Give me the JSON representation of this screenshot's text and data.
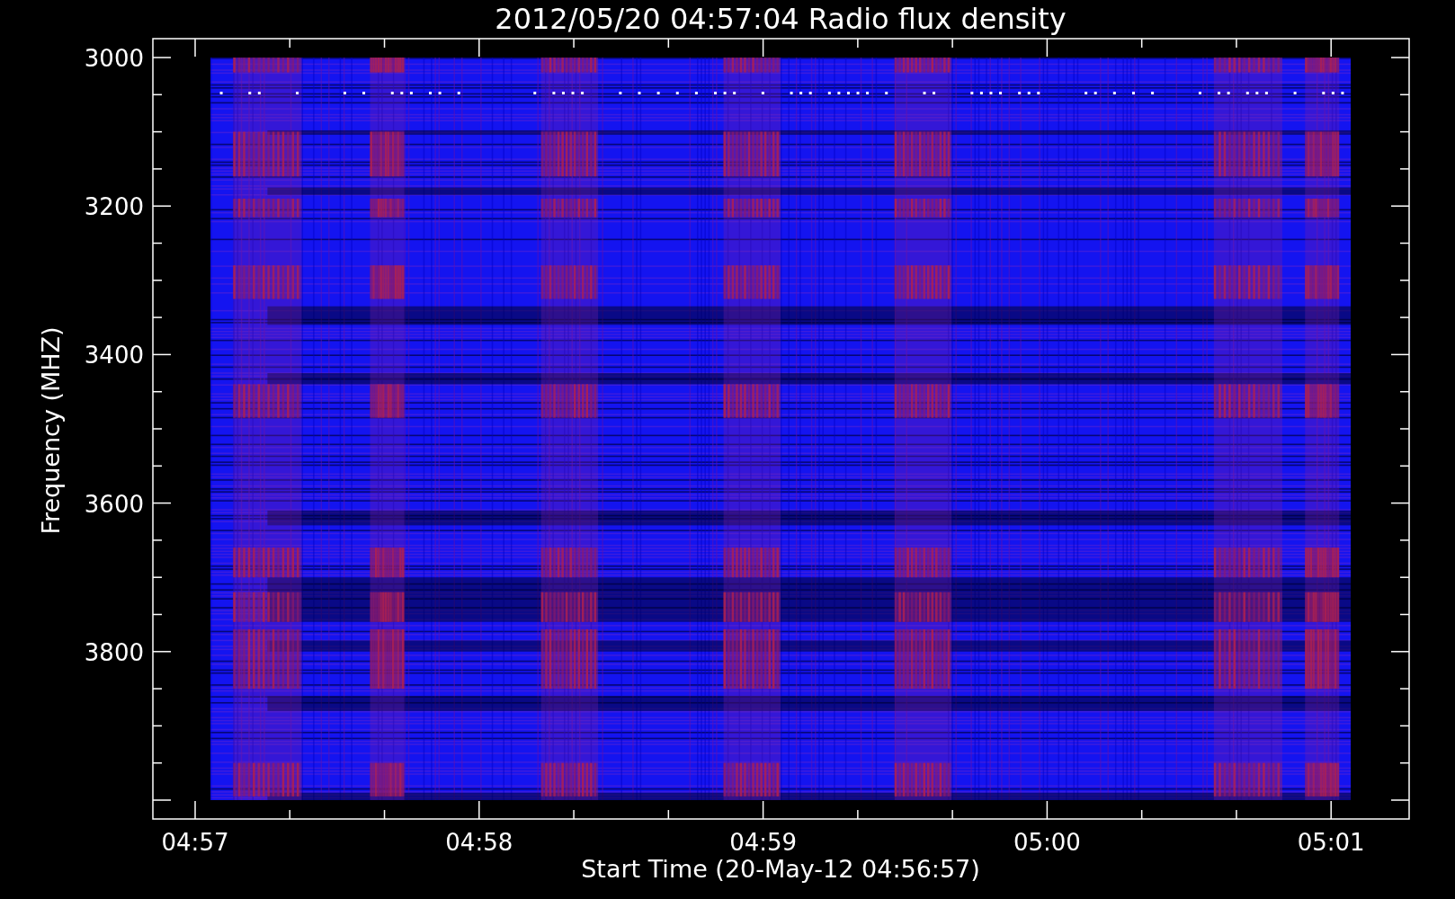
{
  "title": "2012/05/20 04:57:04 Radio flux density",
  "y_axis": {
    "title": "Frequency (MHZ)",
    "tick_labels": [
      "3000",
      "3200",
      "3400",
      "3600",
      "3800"
    ]
  },
  "x_axis": {
    "title": "Start Time (20-May-12 04:56:57)",
    "tick_labels": [
      "04:57",
      "04:58",
      "04:59",
      "05:00",
      "05:01"
    ]
  }
}
